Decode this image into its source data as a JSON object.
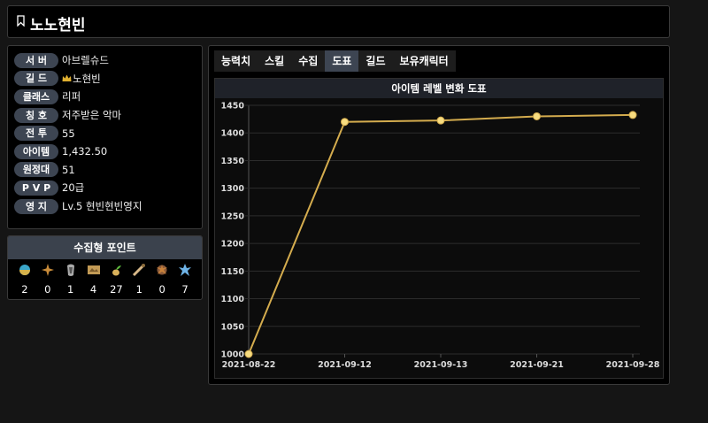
{
  "header": {
    "title": "노노현빈"
  },
  "profile": [
    {
      "label": "서  버",
      "value": "아브렐슈드"
    },
    {
      "label": "길  드",
      "value": "노현빈",
      "crown": true
    },
    {
      "label": "클래스",
      "value": "리퍼"
    },
    {
      "label": "칭  호",
      "value": "저주받은 악마"
    },
    {
      "label": "전  투",
      "value": "55"
    },
    {
      "label": "아이템",
      "value": "1,432.50"
    },
    {
      "label": "원정대",
      "value": "51"
    },
    {
      "label": "P V P",
      "value": "20급"
    },
    {
      "label": "영  지",
      "value": "Lv.5 현빈현빈영지"
    }
  ],
  "collection": {
    "title": "수집형 포인트",
    "items": [
      {
        "icon": "island-heart-icon",
        "count": "2"
      },
      {
        "icon": "star-seed-icon",
        "count": "0"
      },
      {
        "icon": "giant-heart-icon",
        "count": "1"
      },
      {
        "icon": "art-icon",
        "count": "4"
      },
      {
        "icon": "mococo-seed-icon",
        "count": "27"
      },
      {
        "icon": "voyage-icon",
        "count": "1"
      },
      {
        "icon": "ignea-icon",
        "count": "0"
      },
      {
        "icon": "world-tree-leaf-icon",
        "count": "7"
      }
    ]
  },
  "tabs": [
    "능력치",
    "스킬",
    "수집",
    "도표",
    "길드",
    "보유캐릭터"
  ],
  "active_tab": 3,
  "chart_data": {
    "type": "line",
    "title": "아이템 레벨 변화 도표",
    "categories": [
      "2021-08-22",
      "2021-09-12",
      "2021-09-13",
      "2021-09-21",
      "2021-09-28"
    ],
    "series": [
      {
        "values": [
          1000,
          1420,
          1422.5,
          1430,
          1432.5
        ]
      }
    ],
    "ylim": [
      1000,
      1450
    ],
    "yticks": [
      1000,
      1050,
      1100,
      1150,
      1200,
      1250,
      1300,
      1350,
      1400,
      1450
    ],
    "grid": true,
    "colors": {
      "line": "#d4ac4e",
      "point": "#f7dc80"
    }
  }
}
